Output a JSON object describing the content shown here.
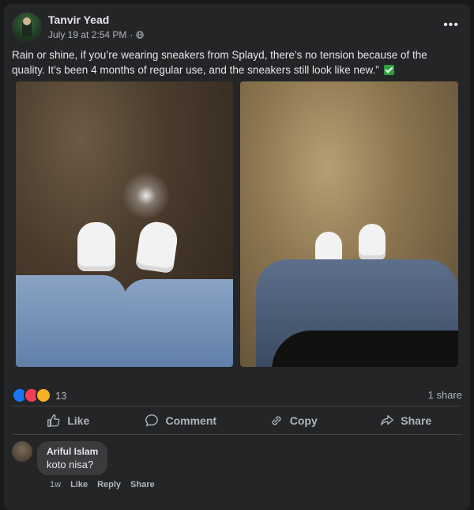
{
  "post": {
    "author": "Tanvir Yead",
    "timestamp": "July 19 at 2:54 PM",
    "separator": "·",
    "privacy_icon": "globe-icon",
    "more_label": "•••",
    "caption": "Rain or shine, if you’re wearing sneakers from Splayd, there’s no tension because of the quality. It’s been 4 months of regular use, and the sneakers still look like new.”"
  },
  "stats": {
    "reaction_count": "13",
    "share_count": "1 share",
    "reaction_icons": [
      "like-icon",
      "love-icon",
      "care-icon"
    ]
  },
  "actions": {
    "like": "Like",
    "comment": "Comment",
    "copy": "Copy",
    "share": "Share"
  },
  "comment": {
    "author": "Ariful Islam",
    "text": "koto nisa?",
    "time": "1w",
    "like": "Like",
    "reply": "Reply",
    "share": "Share"
  },
  "colors": {
    "background": "#18191a",
    "card": "#242526",
    "text": "#e4e6eb",
    "muted": "#b0b3b8",
    "like_blue": "#1877f2"
  }
}
